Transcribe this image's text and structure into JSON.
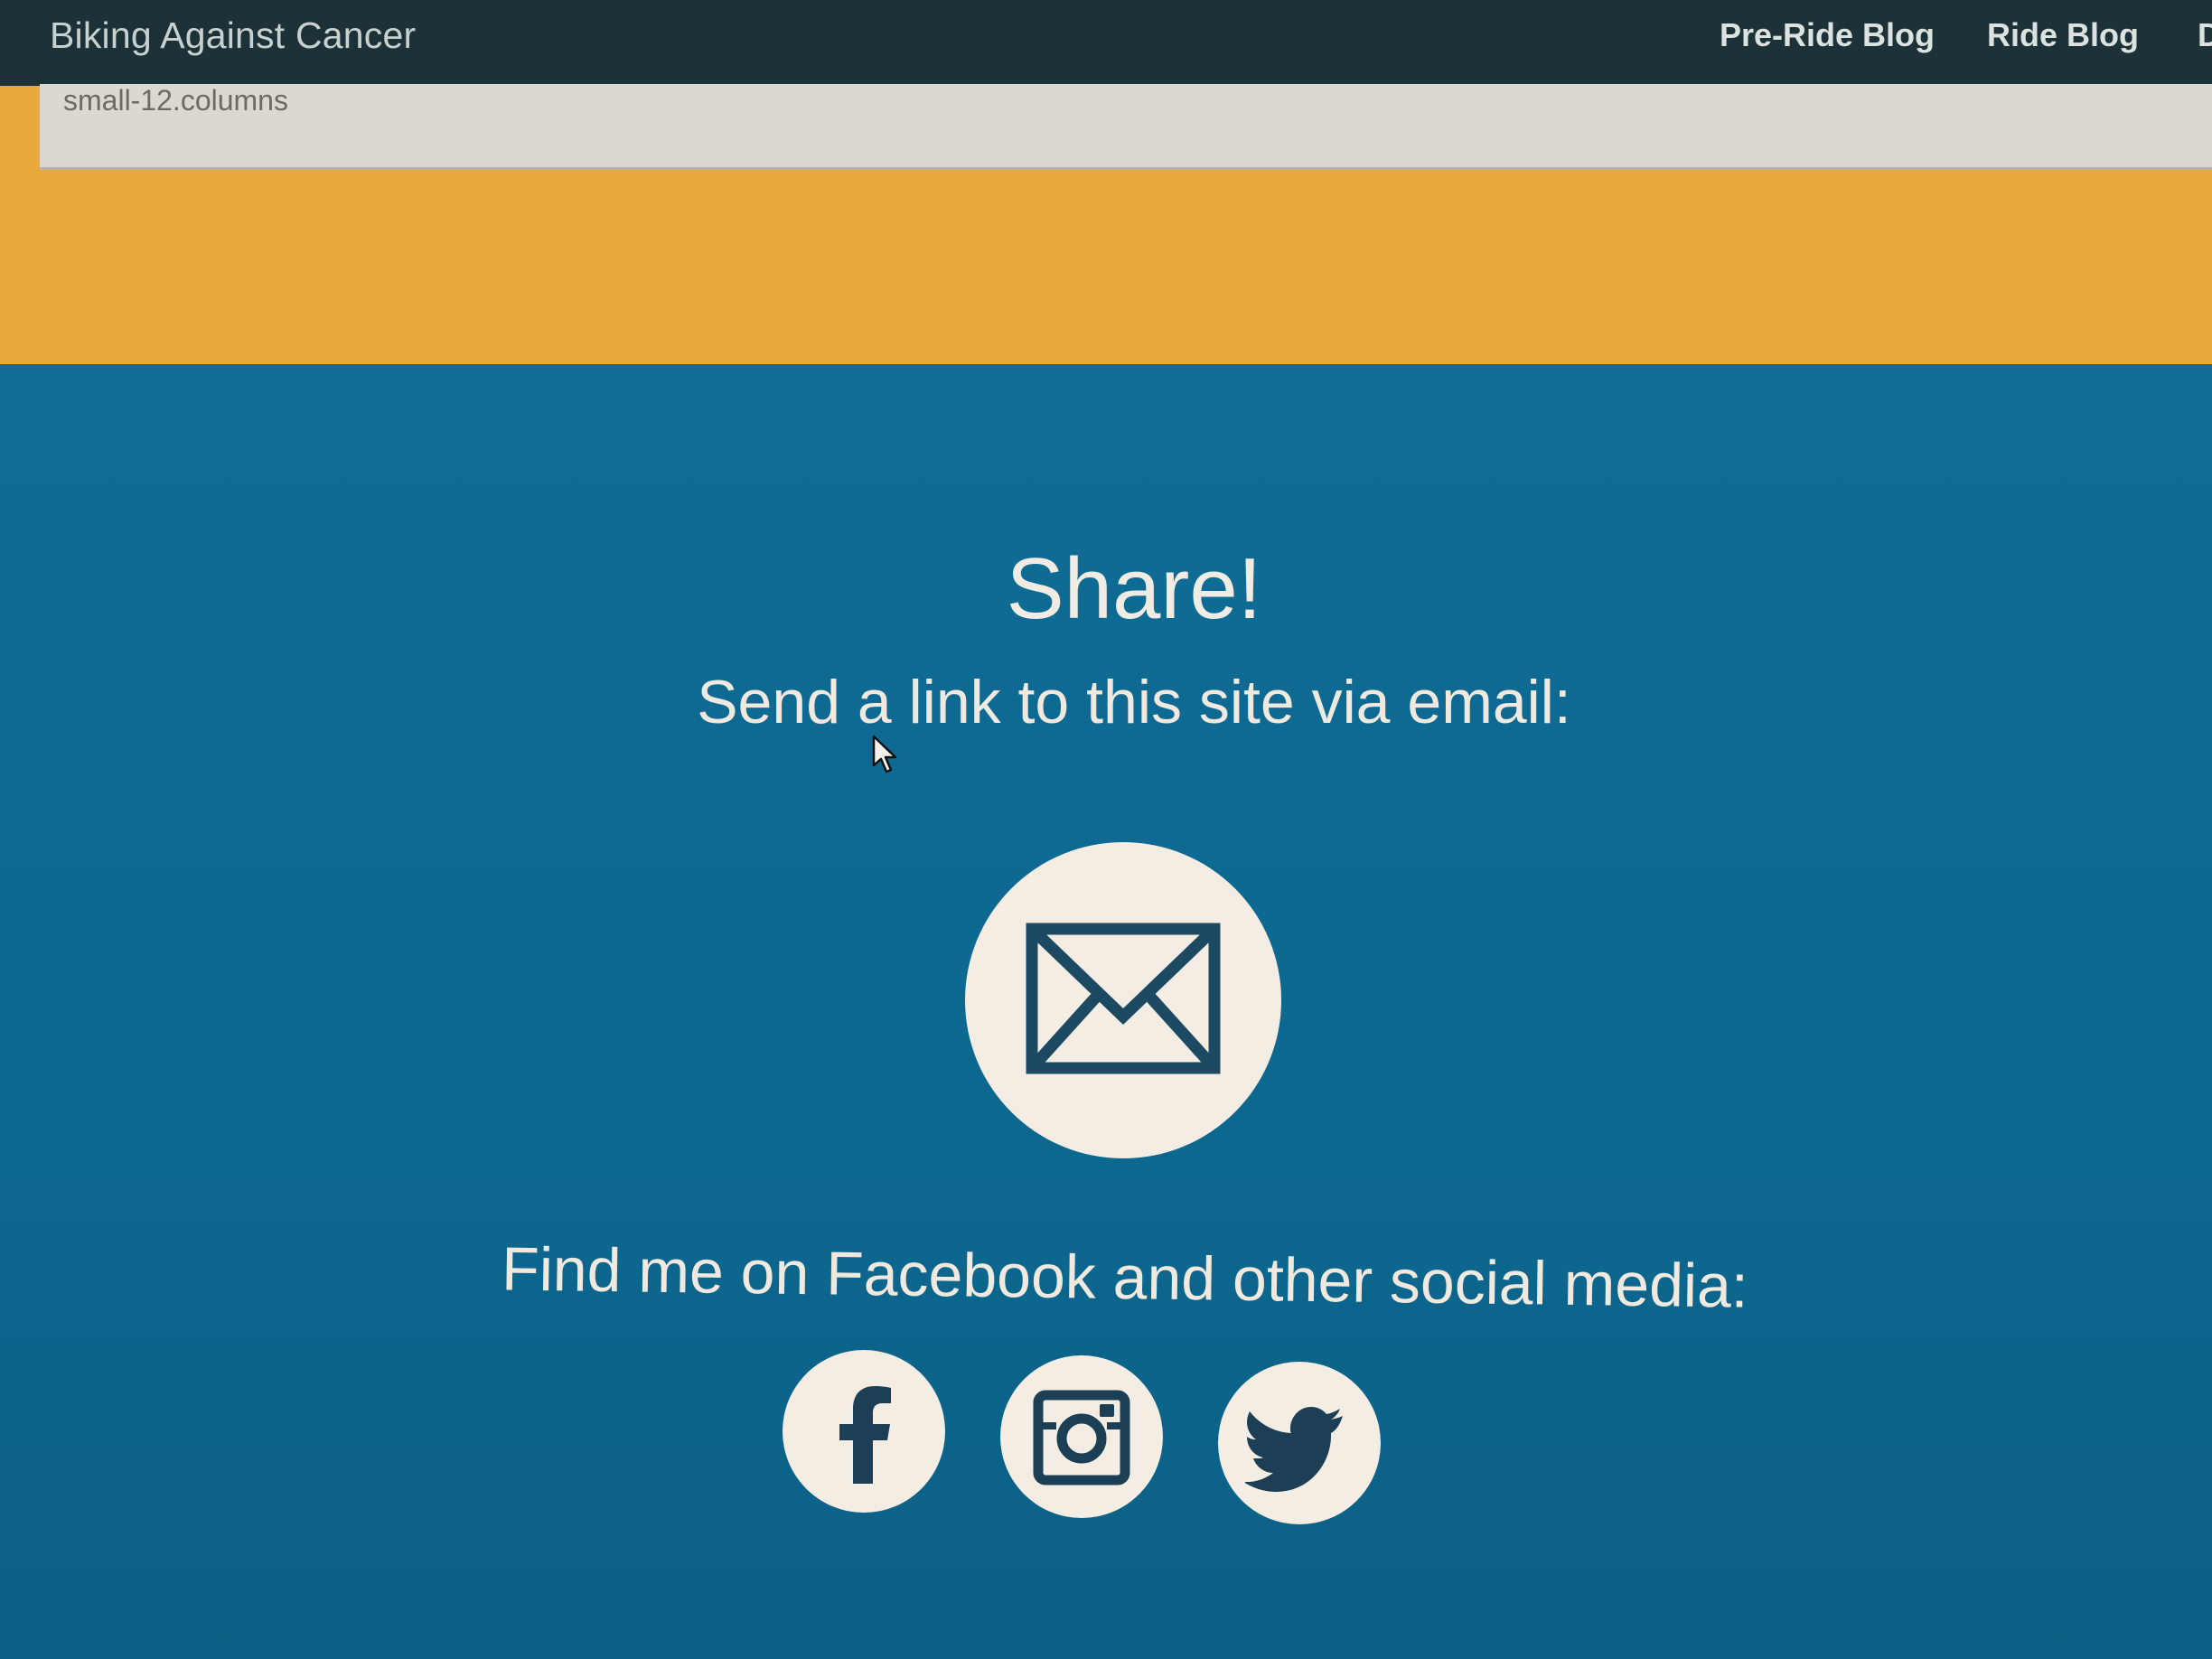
{
  "header": {
    "brand": "Biking Against Cancer",
    "nav": [
      "Pre-Ride Blog",
      "Ride Blog",
      "D"
    ]
  },
  "debug_strip": {
    "label": "small-12.columns"
  },
  "share": {
    "title": "Share!",
    "subtitle": "Send a link to this site via email:",
    "email_icon": "envelope-icon"
  },
  "social": {
    "text": "Find me on Facebook and other social media:",
    "icons": [
      "facebook-icon",
      "instagram-icon",
      "twitter-icon"
    ]
  },
  "colors": {
    "topbar": "#1c3238",
    "orange": "#e9a83b",
    "blue": "#0f6b94",
    "icon_bg": "#f3ede3"
  }
}
